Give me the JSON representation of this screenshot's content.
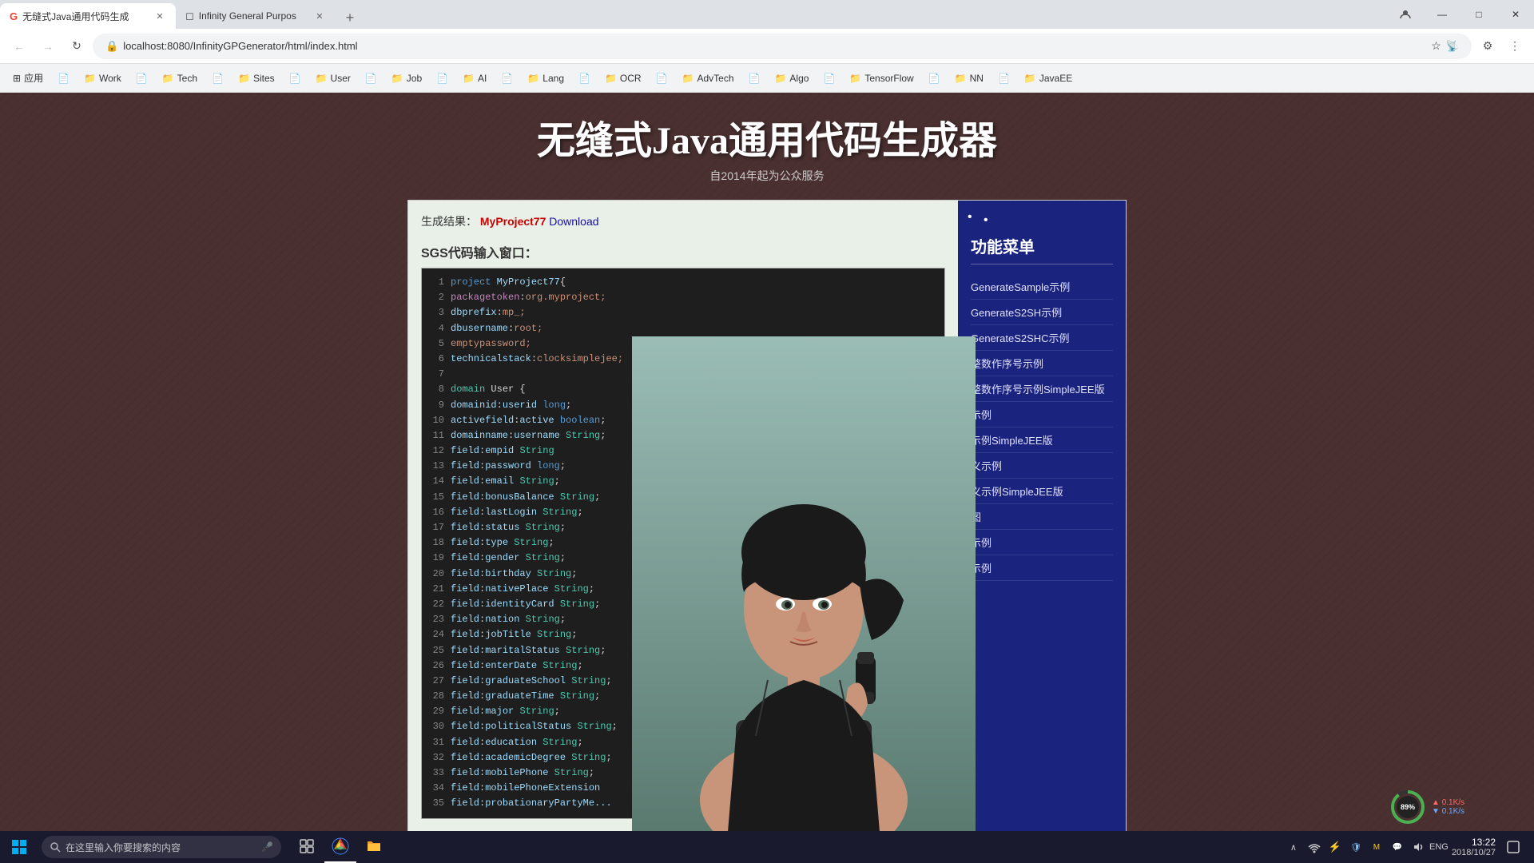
{
  "browser": {
    "tabs": [
      {
        "id": "tab1",
        "favicon": "G",
        "title": "无缝式Java通用代码生成",
        "active": true
      },
      {
        "id": "tab2",
        "favicon": "◻",
        "title": "Infinity General Purpos",
        "active": false
      }
    ],
    "address": "localhost:8080/InfinityGPGenerator/html/index.html",
    "window_controls": {
      "profile": "👤",
      "minimize": "—",
      "maximize": "□",
      "close": "✕"
    }
  },
  "bookmarks": [
    {
      "label": "应用",
      "icon": "⊞"
    },
    {
      "label": "",
      "icon": "📄"
    },
    {
      "label": "Work",
      "icon": "📁"
    },
    {
      "label": "",
      "icon": "📄"
    },
    {
      "label": "Tech",
      "icon": "📁"
    },
    {
      "label": "",
      "icon": "📄"
    },
    {
      "label": "Sites",
      "icon": "📁"
    },
    {
      "label": "",
      "icon": "📄"
    },
    {
      "label": "User",
      "icon": "📁"
    },
    {
      "label": "",
      "icon": "📄"
    },
    {
      "label": "Job",
      "icon": "📁"
    },
    {
      "label": "",
      "icon": "📄"
    },
    {
      "label": "AI",
      "icon": "📁"
    },
    {
      "label": "",
      "icon": "📄"
    },
    {
      "label": "Lang",
      "icon": "📁"
    },
    {
      "label": "",
      "icon": "📄"
    },
    {
      "label": "OCR",
      "icon": "📁"
    },
    {
      "label": "",
      "icon": "📄"
    },
    {
      "label": "AdvTech",
      "icon": "📁"
    },
    {
      "label": "",
      "icon": "📄"
    },
    {
      "label": "Algo",
      "icon": "📁"
    },
    {
      "label": "",
      "icon": "📄"
    },
    {
      "label": "TensorFlow",
      "icon": "📁"
    },
    {
      "label": "",
      "icon": "📄"
    },
    {
      "label": "NN",
      "icon": "📁"
    },
    {
      "label": "",
      "icon": "📄"
    },
    {
      "label": "JavaEE",
      "icon": "📁"
    }
  ],
  "page": {
    "title": "无缝式Java通用代码生成器",
    "subtitle": "自2014年起为公众服务",
    "result_label": "生成结果：",
    "result_project": "MyProject77",
    "result_download": "Download",
    "sgs_label": "SGS代码输入窗口：",
    "code_lines": [
      {
        "num": 1,
        "text": "project MyProject77{",
        "type": "project"
      },
      {
        "num": 2,
        "text": "packagetoken:org.myproject;",
        "type": "package"
      },
      {
        "num": 3,
        "text": "dbprefix:mp_;",
        "type": "db"
      },
      {
        "num": 4,
        "text": "dbusername:root;",
        "type": "db"
      },
      {
        "num": 5,
        "text": "emptypassword;",
        "type": "db"
      },
      {
        "num": 6,
        "text": "technicalstack:clocksimplejee;",
        "type": "tech"
      },
      {
        "num": 7,
        "text": "",
        "type": "plain"
      },
      {
        "num": 8,
        "text": "domain User {",
        "type": "domain"
      },
      {
        "num": 9,
        "text": "domainid:userid long;",
        "type": "field"
      },
      {
        "num": 10,
        "text": "activefield:active boolean;",
        "type": "field"
      },
      {
        "num": 11,
        "text": "domainname:username String;",
        "type": "field"
      },
      {
        "num": 12,
        "text": "field:empid String",
        "type": "field"
      },
      {
        "num": 13,
        "text": "field:password long;",
        "type": "field"
      },
      {
        "num": 14,
        "text": "field:email String;",
        "type": "field"
      },
      {
        "num": 15,
        "text": "field:bonusBalance String;",
        "type": "field"
      },
      {
        "num": 16,
        "text": "field:lastLogin String;",
        "type": "field"
      },
      {
        "num": 17,
        "text": "field:status String;",
        "type": "field"
      },
      {
        "num": 18,
        "text": "field:type String;",
        "type": "field"
      },
      {
        "num": 19,
        "text": "field:gender String;",
        "type": "field"
      },
      {
        "num": 20,
        "text": "field:birthday String;",
        "type": "field"
      },
      {
        "num": 21,
        "text": "field:nativePlace String;",
        "type": "field"
      },
      {
        "num": 22,
        "text": "field:identityCard String;",
        "type": "field"
      },
      {
        "num": 23,
        "text": "field:nation String;",
        "type": "field"
      },
      {
        "num": 24,
        "text": "field:jobTitle String;",
        "type": "field"
      },
      {
        "num": 25,
        "text": "field:maritalStatus String;",
        "type": "field"
      },
      {
        "num": 26,
        "text": "field:enterDate String;",
        "type": "field"
      },
      {
        "num": 27,
        "text": "field:graduateSchool String;",
        "type": "field"
      },
      {
        "num": 28,
        "text": "field:graduateTime String;",
        "type": "field"
      },
      {
        "num": 29,
        "text": "field:major String;",
        "type": "field"
      },
      {
        "num": 30,
        "text": "field:politicalStatus String;",
        "type": "field"
      },
      {
        "num": 31,
        "text": "field:education String;",
        "type": "field"
      },
      {
        "num": 32,
        "text": "field:academicDegree String;",
        "type": "field"
      },
      {
        "num": 33,
        "text": "field:mobilePhone String;",
        "type": "field"
      },
      {
        "num": 34,
        "text": "field:mobilePhoneExtension",
        "type": "field"
      },
      {
        "num": 35,
        "text": "field:probationaryPartyMe...",
        "type": "field"
      }
    ],
    "menu": {
      "title": "功能菜单",
      "items": [
        "GenerateSample示例",
        "GenerateS2SH示例",
        "GenerateS2SHC示例",
        "整数作序号示例",
        "整数作序号示例SimpleJEE版",
        "示例",
        "示例SimpleJEE版",
        "义示例",
        "义示例SimpleJEE版",
        "图",
        "示例",
        "示例"
      ]
    }
  },
  "taskbar": {
    "search_placeholder": "在这里输入你要搜索的内容",
    "clock_time": "13:22",
    "clock_date": "2018/10/27",
    "lang": "ENG"
  },
  "speed_indicator": {
    "percent": "89%",
    "upload": "0.1K/s",
    "download": "0.1K/s"
  }
}
